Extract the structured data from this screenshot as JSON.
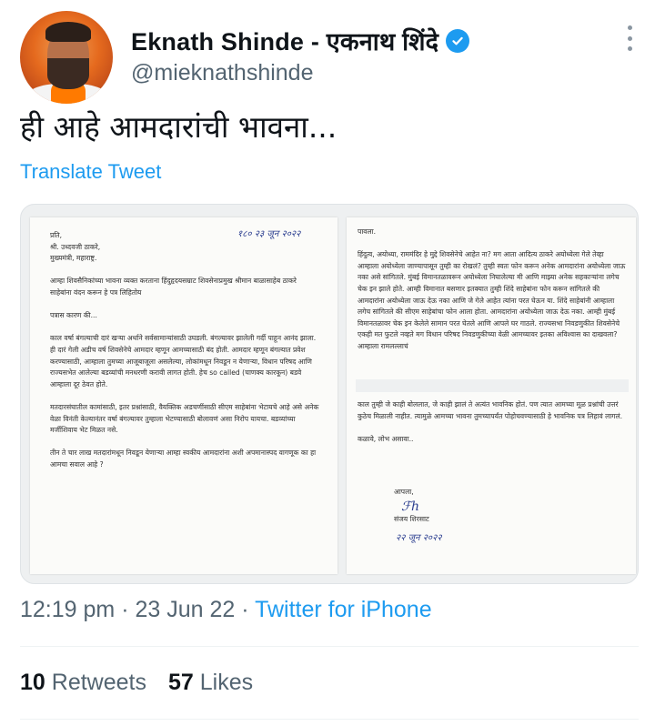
{
  "author": {
    "display_name": "Eknath Shinde - एकनाथ शिंदे",
    "handle": "@mieknathshinde"
  },
  "tweet": {
    "text": "ही आहे आमदारांची भावना...",
    "translate_label": "Translate Tweet"
  },
  "letter": {
    "page1": {
      "date_handwritten": "१८० २३ जून २०२२",
      "body": "प्रति,\nश्री. उध्दवजी ठाकरे,\nमुख्यमंत्री, महाराष्ट्र.\n\nआम्हा शिवसैनिकांच्या भावना व्यक्त करताना हिंदुहृदयसम्राट शिवसेनाप्रमुख श्रीमान बाळासाहेब ठाकरे साहेबांना वंदन करून हे पत्र लिहितोय\n\nपत्रास कारण की...\n\nकाल वर्षा बंगल्याची दारं खऱ्या अर्थाने सर्वसामान्यांसाठी उघडली. बंगल्यावर झालेली गर्दी पाहून आनंद झाला. ही दारं गेली अडीच वर्ष शिवसेनेचे आमदार म्हणून आमच्यासाठी बंद होती. आमदार म्हणून बंगल्यात प्रवेश करण्यासाठी, आम्हाला तुमच्या आजूबाजूला असलेल्या, लोकांमधून निवडून न येणाऱ्या, विधान परिषद आणि राज्यसभेत आलेल्या बडव्यांची मनधरणी करावी लागत होती. हेच so called (चाणक्य कारकून) बडवे आम्हाला दूर ठेवत होते.\n\nमतदारसंघातील कामांसाठी, इतर प्रश्नांसाठी, वैयक्तिक अडचणींसाठी सीएम साहेबांना भेटायचे आहे असे अनेक वेळा विनंती केल्यानंतर वर्षा बंगल्यावर तुम्हाला भेटण्यासाठी बोलावणं असा निरोप यायचा. बडव्यांच्या मर्जीशिवाय भेट मिळत नसे.\n\nतीन ते चार लाख मतदारांमधून निवडून येणाऱ्या आम्हा स्वकीय आमदारांना अशी अपमानास्पद वागणूक का हा आमचा सवाल आहे ?"
    },
    "page2": {
      "body": "पावला.\n\nहिंदुत्व, अयोध्या, राममंदिर हे मुद्दे शिवसेनेचे आहेत ना? मग आता आदित्य ठाकरे अयोध्येला गेले तेव्हा आम्हाला अयोध्येला जाण्यापासून तुम्ही का रोखलं? तुम्ही स्वतः फोन करून अनेक आमदारांना अयोध्येला जाऊ नका असे सांगितले. मुंबई विमानतळावरून अयोध्येला निघालेल्या मी आणि माझ्या अनेक सहकाऱ्यांना लगेच चेक इन झाले होते. आम्ही विमानात बसणार इतक्यात तुम्ही शिंदे साहेबांना फोन करून सांगितले की आमदारांना अयोध्येला जाऊ देऊ नका आणि जे गेले आहेत त्यांना परत घेऊन या. शिंदे साहेबांनी आम्हाला लगेच सांगितले की सीएम साहेबांचा फोन आला होता. आमदारांना अयोध्येला जाऊ देऊ नका. आम्ही मुंबई विमानतळावर चेक इन केलेले सामान परत घेतले आणि आपले घर गाठले. राज्यसभा निवडणुकीत शिवसेनेचे एकही मत फुटले नव्हते मग विधान परिषद निवडणुकीच्या वेळी आमच्यावर इतका अविश्वास का दाखवला? आम्हाला रामलल्लाचं",
      "body2": "काल तुम्ही जे काही बोललात, जे काही झालं ते अत्यंत भावनिक होतं. पण त्यात आमच्या मूळ प्रश्नांची उत्तरं कुठेच मिळाली नाहीत. त्यामुळे आमच्या भावना तुमच्यापर्यंत पोहोचवण्यासाठी हे भावनिक पत्र लिहावं लागलं.\n\nकळावे, लोभ असावा..",
      "signoff": "आपला,",
      "signature": "संजय शिरसाट",
      "signature_date": "२२ जून २०२२"
    }
  },
  "meta": {
    "time": "12:19 pm",
    "sep1": " · ",
    "date": "23 Jun 22",
    "sep2": " · ",
    "source": "Twitter for iPhone"
  },
  "stats": {
    "retweets_count": "10",
    "retweets_label": "Retweets",
    "likes_count": "57",
    "likes_label": "Likes"
  },
  "colors": {
    "accent": "#1d9bf0",
    "secondary_text": "#536471",
    "primary_text": "#0f1419"
  },
  "icons": {
    "verified": "verified-badge-icon",
    "more": "more-dots-icon"
  }
}
